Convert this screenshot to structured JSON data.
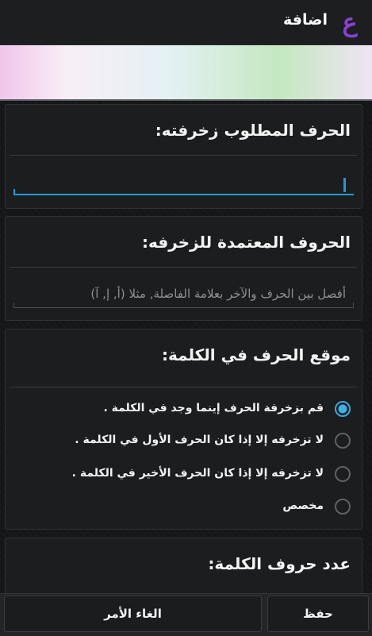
{
  "actionbar": {
    "app_icon_glyph": "ع",
    "title": "اضافة"
  },
  "sections": {
    "char": {
      "title": "الحرف المطلوب زخرفته:",
      "value": ""
    },
    "letters": {
      "title": "الحروف المعتمدة للزخرفه:",
      "placeholder": "أفصل بين الحرف والآخر بعلامة الفاصلة, مثلا (أ, إ, آ)"
    },
    "position": {
      "title": "موقع الحرف في الكلمة:",
      "options": [
        {
          "label": "قم بزخرفة الحرف إينما وجد في الكلمة .",
          "checked": true
        },
        {
          "label": "لا تزخرفه إلا إذا كان الحرف الأول في الكلمة .",
          "checked": false
        },
        {
          "label": "لا تزخرفه إلا إذا كان الحرف الأخير في الكلمة .",
          "checked": false
        },
        {
          "label": "مخصص",
          "checked": false
        }
      ]
    },
    "count": {
      "title": "عدد حروف الكلمة:"
    }
  },
  "buttons": {
    "cancel": "الغاء الأمر",
    "save": "حفظ"
  },
  "colors": {
    "accent": "#1f9ad6",
    "app_icon": "#8a3fd1",
    "background": "#17191b"
  }
}
